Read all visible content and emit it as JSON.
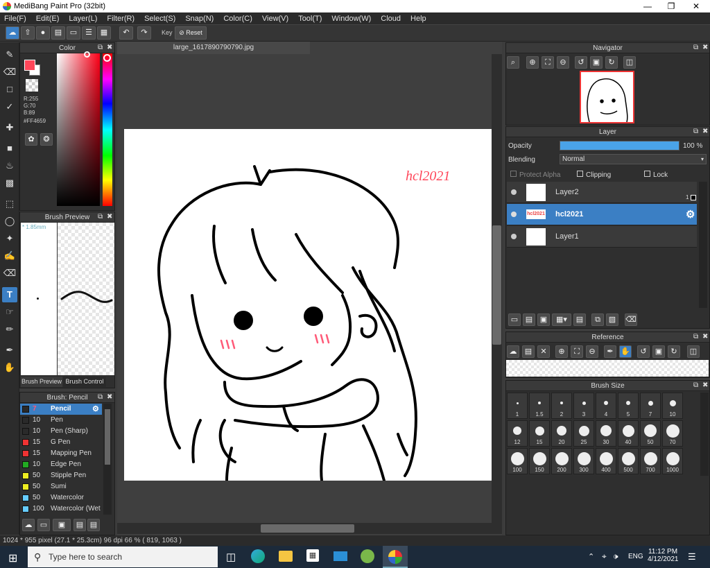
{
  "app": {
    "title": "MediBang Paint Pro (32bit)"
  },
  "menu": [
    "File(F)",
    "Edit(E)",
    "Layer(L)",
    "Filter(R)",
    "Select(S)",
    "Snap(N)",
    "Color(C)",
    "View(V)",
    "Tool(T)",
    "Window(W)",
    "Cloud",
    "Help"
  ],
  "toolbar": {
    "key_label": "Key",
    "reset_label": "Reset"
  },
  "color_panel": {
    "title": "Color",
    "r": "R:255",
    "g": "G:70",
    "b": "B:89",
    "hex": "#FF4659",
    "fg_color": "#ff4659"
  },
  "brush_preview": {
    "title": "Brush Preview",
    "size": "* 1.85mm",
    "tab1": "Brush Preview",
    "tab2": "Brush Control"
  },
  "brush_list": {
    "title": "Brush: Pencil",
    "items": [
      {
        "size": "7",
        "name": "Pencil",
        "color": "#2a2a2a"
      },
      {
        "size": "10",
        "name": "Pen",
        "color": "#2a2a2a"
      },
      {
        "size": "10",
        "name": "Pen (Sharp)",
        "color": "#2a2a2a"
      },
      {
        "size": "15",
        "name": "G Pen",
        "color": "#e33"
      },
      {
        "size": "15",
        "name": "Mapping Pen",
        "color": "#e33"
      },
      {
        "size": "10",
        "name": "Edge Pen",
        "color": "#2a2"
      },
      {
        "size": "50",
        "name": "Stipple Pen",
        "color": "#ee2"
      },
      {
        "size": "50",
        "name": "Sumi",
        "color": "#ee2"
      },
      {
        "size": "50",
        "name": "Watercolor",
        "color": "#6cf"
      },
      {
        "size": "100",
        "name": "Watercolor (Wet",
        "color": "#6cf"
      }
    ]
  },
  "document": {
    "tab": "large_1617890790790.jpg",
    "watermark": "hcl2021"
  },
  "navigator": {
    "title": "Navigator"
  },
  "layer_panel": {
    "title": "Layer",
    "opacity_label": "Opacity",
    "opacity_value": "100 %",
    "opacity": 1.0,
    "blending_label": "Blending",
    "blending_value": "Normal",
    "protect_alpha": "Protect Alpha",
    "clipping": "Clipping",
    "lock": "Lock",
    "layers": [
      {
        "name": "Layer2",
        "badge": "1"
      },
      {
        "name": "hcl2021",
        "thumb": "hcl2021"
      },
      {
        "name": "Layer1"
      }
    ]
  },
  "reference": {
    "title": "Reference"
  },
  "brush_size": {
    "title": "Brush Size",
    "sizes": [
      "1",
      "1.5",
      "2",
      "3",
      "4",
      "5",
      "7",
      "10",
      "12",
      "15",
      "20",
      "25",
      "30",
      "40",
      "50",
      "70",
      "100",
      "150",
      "200",
      "300",
      "400",
      "500",
      "700",
      "1000"
    ]
  },
  "status": {
    "text": "1024 * 955 pixel  (27.1 * 25.3cm)  96 dpi  66 %  ( 819, 1063 )"
  },
  "taskbar": {
    "search_placeholder": "Type here to search",
    "lang": "ENG",
    "time": "11:12 PM",
    "date": "4/12/2021"
  }
}
